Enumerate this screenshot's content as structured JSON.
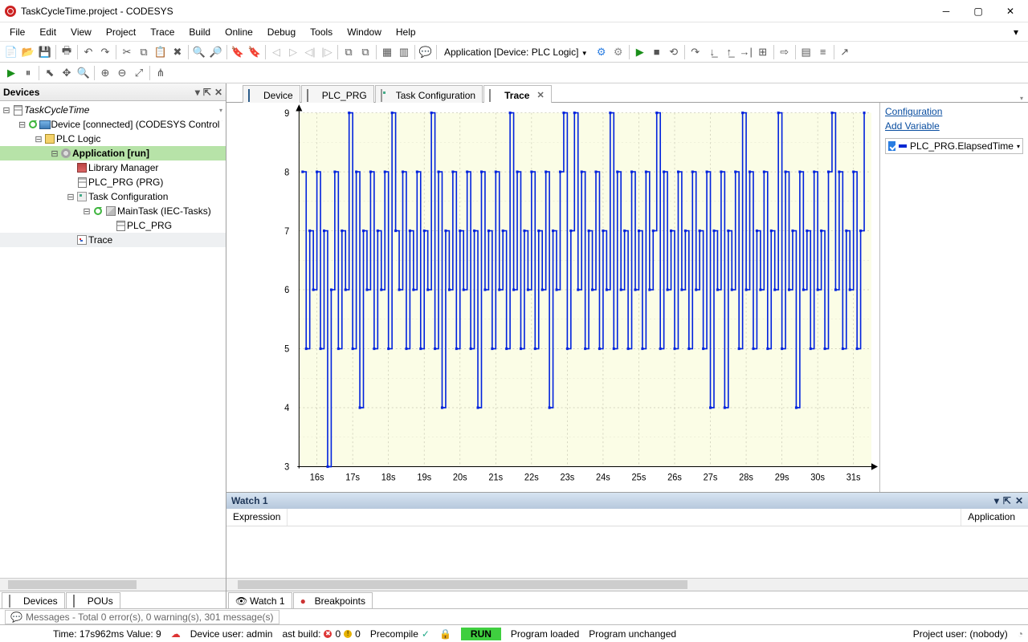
{
  "window": {
    "title": "TaskCycleTime.project - CODESYS"
  },
  "menu": [
    "File",
    "Edit",
    "View",
    "Project",
    "Trace",
    "Build",
    "Online",
    "Debug",
    "Tools",
    "Window",
    "Help"
  ],
  "toolbar": {
    "appctx": "Application [Device: PLC Logic]"
  },
  "devices": {
    "title": "Devices",
    "root": "TaskCycleTime",
    "device": "Device [connected] (CODESYS Control Wi",
    "plcLogic": "PLC Logic",
    "application": "Application [run]",
    "library": "Library Manager",
    "prg": "PLC_PRG (PRG)",
    "taskcfg": "Task Configuration",
    "maintask": "MainTask (IEC-Tasks)",
    "plcprg2": "PLC_PRG",
    "trace": "Trace"
  },
  "leftTabs": {
    "devices": "Devices",
    "pous": "POUs"
  },
  "editorTabs": [
    "Device",
    "PLC_PRG",
    "Task Configuration",
    "Trace"
  ],
  "trace": {
    "cfg": "Configuration",
    "addvar": "Add Variable",
    "var1": "PLC_PRG.ElapsedTime"
  },
  "watch": {
    "title": "Watch 1",
    "col1": "Expression",
    "col2": "Application",
    "tabs": [
      "Watch 1",
      "Breakpoints"
    ]
  },
  "messages": "Messages - Total 0 error(s), 0 warning(s), 301 message(s)",
  "status": {
    "time": "Time: 17s962ms  Value: 9",
    "devuser": "Device user: admin",
    "build": "ast build:",
    "err": "0",
    "warn": "0",
    "precompile": "Precompile",
    "run": "RUN",
    "loaded": "Program loaded",
    "changed": "Program unchanged",
    "projuser": "Project user: (nobody)"
  },
  "chart_data": {
    "type": "line",
    "title": "",
    "xlabel": "",
    "ylabel": "",
    "xlim": [
      15.5,
      31.5
    ],
    "ylim": [
      3,
      9
    ],
    "x_ticks": [
      "16s",
      "17s",
      "18s",
      "19s",
      "20s",
      "21s",
      "22s",
      "23s",
      "24s",
      "25s",
      "26s",
      "27s",
      "28s",
      "29s",
      "30s",
      "31s"
    ],
    "y_ticks": [
      3,
      4,
      5,
      6,
      7,
      8,
      9
    ],
    "series": [
      {
        "name": "PLC_PRG.ElapsedTime",
        "color": "#0022dd",
        "x": [
          15.6,
          15.7,
          15.8,
          15.9,
          16.0,
          16.1,
          16.2,
          16.3,
          16.4,
          16.5,
          16.6,
          16.7,
          16.8,
          16.9,
          17.0,
          17.1,
          17.2,
          17.3,
          17.4,
          17.5,
          17.6,
          17.7,
          17.8,
          17.9,
          18.0,
          18.1,
          18.2,
          18.3,
          18.4,
          18.5,
          18.6,
          18.7,
          18.8,
          18.9,
          19.0,
          19.1,
          19.2,
          19.3,
          19.4,
          19.5,
          19.6,
          19.7,
          19.8,
          19.9,
          20.0,
          20.1,
          20.2,
          20.3,
          20.4,
          20.5,
          20.6,
          20.7,
          20.8,
          20.9,
          21.0,
          21.1,
          21.2,
          21.3,
          21.4,
          21.5,
          21.6,
          21.7,
          21.8,
          21.9,
          22.0,
          22.1,
          22.2,
          22.3,
          22.4,
          22.5,
          22.6,
          22.7,
          22.8,
          22.9,
          23.0,
          23.1,
          23.2,
          23.3,
          23.4,
          23.5,
          23.6,
          23.7,
          23.8,
          23.9,
          24.0,
          24.1,
          24.2,
          24.3,
          24.4,
          24.5,
          24.6,
          24.7,
          24.8,
          24.9,
          25.0,
          25.1,
          25.2,
          25.3,
          25.4,
          25.5,
          25.6,
          25.7,
          25.8,
          25.9,
          26.0,
          26.1,
          26.2,
          26.3,
          26.4,
          26.5,
          26.6,
          26.7,
          26.8,
          26.9,
          27.0,
          27.1,
          27.2,
          27.3,
          27.4,
          27.5,
          27.6,
          27.7,
          27.8,
          27.9,
          28.0,
          28.1,
          28.2,
          28.3,
          28.4,
          28.5,
          28.6,
          28.7,
          28.8,
          28.9,
          29.0,
          29.1,
          29.2,
          29.3,
          29.4,
          29.5,
          29.6,
          29.7,
          29.8,
          29.9,
          30.0,
          30.1,
          30.2,
          30.3,
          30.4,
          30.5,
          30.6,
          30.7,
          30.8,
          30.9,
          31.0,
          31.1,
          31.2,
          31.3
        ],
        "values": [
          8,
          5,
          7,
          6,
          8,
          5,
          7,
          3,
          6,
          8,
          5,
          7,
          6,
          9,
          5,
          8,
          4,
          7,
          6,
          8,
          5,
          7,
          6,
          8,
          5,
          9,
          7,
          6,
          8,
          5,
          7,
          6,
          8,
          5,
          7,
          6,
          9,
          5,
          8,
          4,
          7,
          6,
          8,
          5,
          7,
          6,
          8,
          5,
          7,
          4,
          8,
          6,
          7,
          5,
          8,
          6,
          7,
          5,
          9,
          6,
          8,
          5,
          7,
          6,
          8,
          5,
          7,
          6,
          8,
          4,
          7,
          6,
          8,
          9,
          5,
          7,
          9,
          6,
          8,
          5,
          7,
          6,
          8,
          5,
          7,
          6,
          9,
          5,
          8,
          6,
          7,
          5,
          8,
          6,
          7,
          5,
          8,
          6,
          7,
          9,
          5,
          8,
          6,
          7,
          5,
          8,
          6,
          7,
          5,
          8,
          6,
          7,
          5,
          8,
          4,
          7,
          6,
          8,
          4,
          7,
          6,
          8,
          5,
          9,
          6,
          8,
          5,
          7,
          6,
          8,
          5,
          7,
          6,
          9,
          5,
          8,
          6,
          7,
          4,
          8,
          6,
          7,
          5,
          8,
          6,
          7,
          5,
          8,
          9,
          6,
          8,
          5,
          7,
          6,
          8,
          5,
          7,
          9
        ]
      }
    ]
  }
}
